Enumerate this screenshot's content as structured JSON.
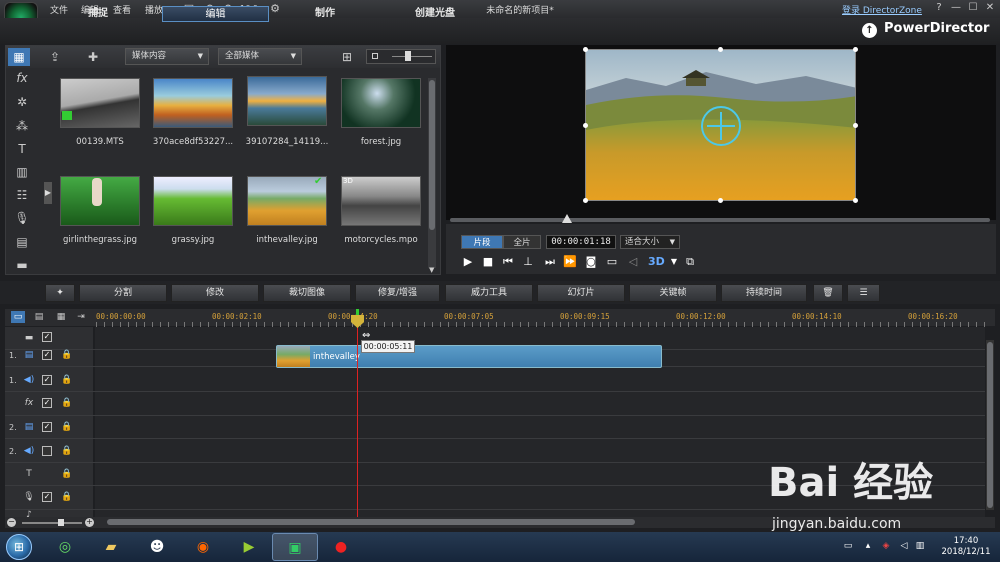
{
  "menu": [
    "文件",
    "编辑",
    "查看",
    "播放"
  ],
  "doc_title": "未命名的新项目*",
  "signin": "登录 DirectorZone",
  "window_controls": [
    "?",
    "—",
    "☐",
    "✕"
  ],
  "modes": [
    "捕捉",
    "编辑",
    "制作",
    "创建光盘"
  ],
  "brand": "PowerDirector",
  "library": {
    "filter1": "媒体内容",
    "filter2": "全部媒体",
    "items": [
      {
        "label": "00139.MTS"
      },
      {
        "label": "370ace8df53227..."
      },
      {
        "label": "39107284_14119..."
      },
      {
        "label": "forest.jpg"
      },
      {
        "label": "girlinthegrass.jpg"
      },
      {
        "label": "grassy.jpg"
      },
      {
        "label": "inthevalley.jpg"
      },
      {
        "label": "motorcycles.mpo"
      }
    ],
    "badge_3d": "3D"
  },
  "preview": {
    "clip_tab": "片段",
    "full_tab": "全片",
    "timecode": "00:00:01:18",
    "fit": "适合大小",
    "btn3d": "3D"
  },
  "toolbar": [
    "分割",
    "修改",
    "裁切图像",
    "修复/增强",
    "威力工具",
    "幻灯片",
    "关键帧",
    "持续时间"
  ],
  "ruler": [
    "00:00:00:00",
    "00:00:02:10",
    "00:00:04:20",
    "00:00:07:05",
    "00:00:09:15",
    "00:00:12:00",
    "00:00:14:10",
    "00:00:16:20"
  ],
  "tracks": [
    {
      "num": "1.",
      "type": "video",
      "checked": true
    },
    {
      "num": "1.",
      "type": "audio",
      "checked": true
    },
    {
      "num": "",
      "type": "fx",
      "checked": true
    },
    {
      "num": "2.",
      "type": "video",
      "checked": true
    },
    {
      "num": "2.",
      "type": "audio",
      "checked": false
    },
    {
      "num": "",
      "type": "title",
      "checked": null
    },
    {
      "num": "",
      "type": "voice",
      "checked": true
    },
    {
      "num": "",
      "type": "music",
      "checked": true
    }
  ],
  "clip": {
    "name": "inthevalley"
  },
  "tooltip": "00:00:05:11",
  "clock": {
    "time": "17:40",
    "date": "2018/12/11"
  },
  "watermark": {
    "text": "Bai 经验",
    "url": "jingyan.baidu.com"
  }
}
